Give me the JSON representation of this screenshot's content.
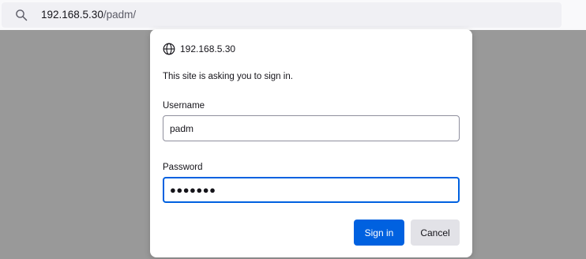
{
  "address_bar": {
    "url_host": "192.168.5.30",
    "url_path": "/padm/",
    "icon": "search-icon"
  },
  "auth_dialog": {
    "icon": "globe-icon",
    "host": "192.168.5.30",
    "message": "This site is asking you to sign in.",
    "username": {
      "label": "Username",
      "value": "padm"
    },
    "password": {
      "label": "Password",
      "value_masked": "●●●●●●●",
      "focused": true
    },
    "sign_in_label": "Sign in",
    "cancel_label": "Cancel",
    "colors": {
      "primary": "#0061e0",
      "secondary": "#e2e2e7"
    }
  }
}
